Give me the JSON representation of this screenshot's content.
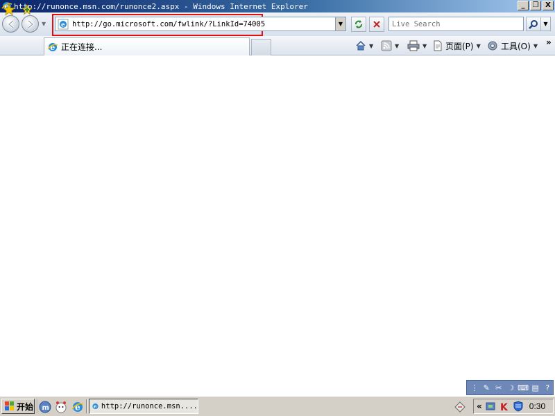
{
  "window": {
    "title": "http://runonce.msn.com/runonce2.aspx - Windows Internet Explorer",
    "minimize_glyph": "_",
    "maximize_glyph": "❐",
    "close_glyph": "X"
  },
  "navbar": {
    "address_url": "http://go.microsoft.com/fwlink/?LinkId=74005",
    "search_placeholder": "Live Search"
  },
  "tabs": [
    {
      "label": "正在连接..."
    }
  ],
  "commands": {
    "page_label": "页面(P)",
    "tools_label": "工具(O)",
    "more_glyph": "»"
  },
  "taskbar": {
    "start_label": "开始",
    "task_label": "http://runonce.msn....",
    "tray_chevron": "«",
    "clock": "0:30"
  },
  "colors": {
    "highlight": "#e01010",
    "titlebar_start": "#0a246a",
    "taskbar": "#d4d0c8"
  },
  "icons": [
    "ie-icon",
    "back-icon",
    "forward-icon",
    "refresh-icon",
    "stop-icon",
    "search-icon",
    "favorites-star-icon",
    "add-favorite-icon",
    "home-icon",
    "feeds-icon",
    "print-icon",
    "page-icon",
    "tools-gear-icon",
    "windows-flag-icon"
  ]
}
